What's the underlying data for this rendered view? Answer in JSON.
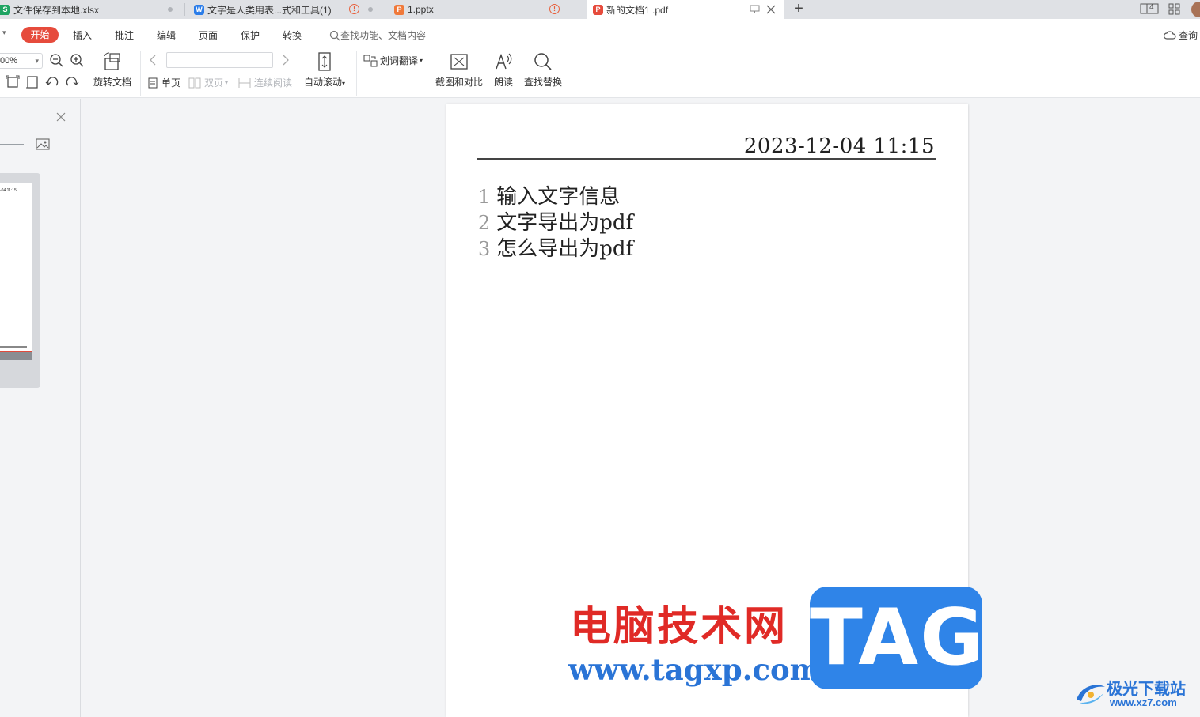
{
  "tabs": [
    {
      "label": "文件保存到本地.xlsx",
      "icon": "S",
      "color": "#1fa463"
    },
    {
      "label": "文字是人类用表...式和工具(1)",
      "icon": "W",
      "color": "#2b7de9"
    },
    {
      "label": "1.pptx",
      "icon": "P",
      "color": "#f0793a"
    },
    {
      "label": "新的文档1 .pdf",
      "icon": "P",
      "color": "#e64b3c"
    }
  ],
  "window_controls": {
    "badge": "4"
  },
  "menu": {
    "active": "开始",
    "items": [
      "插入",
      "批注",
      "编辑",
      "页面",
      "保护",
      "转换"
    ],
    "search_placeholder": "查找功能、文档内容",
    "query_label": "查询"
  },
  "toolbar": {
    "zoom": "00%",
    "rotate_doc": "旋转文档",
    "single_page": "单页",
    "double_page": "双页",
    "continuous": "连续阅读",
    "auto_scroll": "自动滚动",
    "word_translate": "划词翻译",
    "screenshot_compare": "截图和对比",
    "read_aloud": "朗读",
    "find_replace": "查找替换"
  },
  "thumbnail": {
    "date_text": "-04 11:15"
  },
  "document": {
    "header_date": "2023-12-04  11:15",
    "lines": [
      {
        "num": "1",
        "text": "输入文字信息"
      },
      {
        "num": "2",
        "text": "文字导出为pdf"
      },
      {
        "num": "3",
        "text": "怎么导出为pdf"
      }
    ]
  },
  "watermark": {
    "site_name": "电脑技术网",
    "url": "www.tagxp.com",
    "tag": "TAG",
    "logo_text": "极光下载站",
    "logo_url": "www.xz7.com"
  },
  "colors": {
    "accent": "#e64b3c",
    "watermark_blue": "#2f84e8",
    "watermark_red": "#e02a26"
  }
}
